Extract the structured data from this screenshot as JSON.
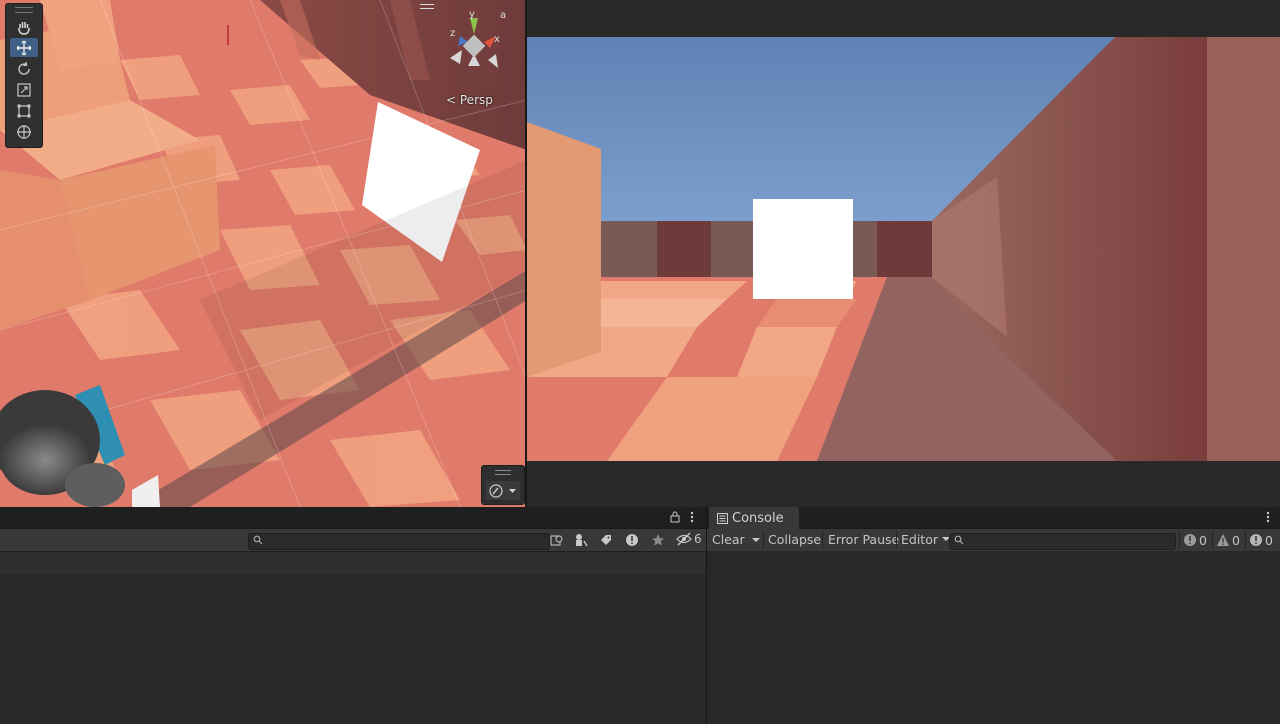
{
  "scene_view": {
    "tools": [
      {
        "name": "hand-tool",
        "icon": "hand-icon",
        "active": false
      },
      {
        "name": "move-tool",
        "icon": "move-icon",
        "active": true
      },
      {
        "name": "rotate-tool",
        "icon": "rotate-icon",
        "active": false
      },
      {
        "name": "scale-tool",
        "icon": "scale-icon",
        "active": false
      },
      {
        "name": "rect-tool",
        "icon": "rect-icon",
        "active": false
      },
      {
        "name": "transform-tool",
        "icon": "transform-icon",
        "active": false
      }
    ],
    "gizmo": {
      "y_label": "y",
      "z_label": "z",
      "x_label": "x"
    },
    "persp_label": "Persp",
    "overlay_icon": "compass-icon"
  },
  "project_panel": {
    "hidden_count": "6",
    "icons": [
      "lock-icon",
      "kebab-menu-icon",
      "search-icon",
      "search-by-type-icon",
      "search-by-label-icon",
      "warning-icon",
      "star-icon",
      "eye-slash-icon"
    ]
  },
  "console": {
    "tab_label": "Console",
    "clear_label": "Clear",
    "collapse_label": "Collapse",
    "error_pause_label": "Error Pause",
    "editor_label": "Editor",
    "log_count": "0",
    "warning_count": "0",
    "error_count": "0"
  }
}
